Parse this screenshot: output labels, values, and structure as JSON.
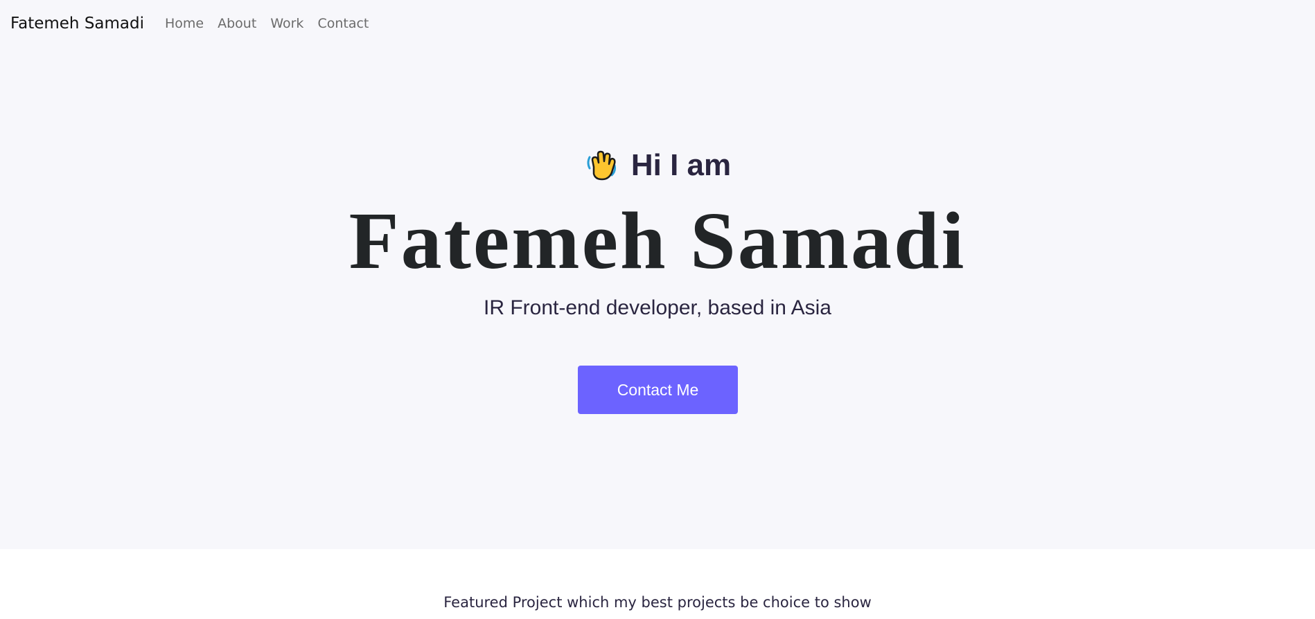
{
  "nav": {
    "brand": "Fatemeh Samadi",
    "links": [
      {
        "label": "Home"
      },
      {
        "label": "About"
      },
      {
        "label": "Work"
      },
      {
        "label": "Contact"
      }
    ]
  },
  "hero": {
    "greeting_icon": "waving-hand-icon",
    "greeting": "Hi I am",
    "name": "Fatemeh Samadi",
    "subtitle": "IR Front-end developer, based in Asia",
    "cta_label": "Contact Me"
  },
  "featured": {
    "heading": "Featured Project which my best projects be choice to show"
  },
  "colors": {
    "accent": "#6c63ff",
    "hero_background": "#f7f7fb",
    "text_dark": "#222527"
  }
}
